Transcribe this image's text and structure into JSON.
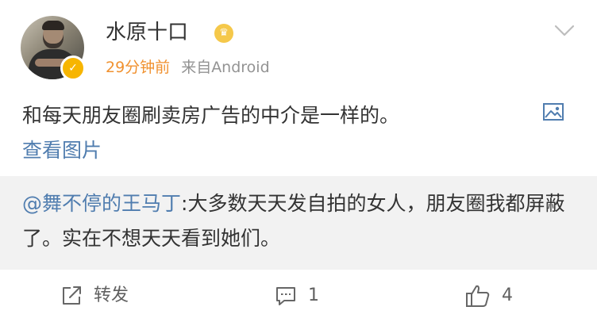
{
  "post": {
    "author": "水原十口",
    "time": "29分钟前",
    "source": "来自Android",
    "text": "和每天朋友圈刷卖房广告的中介是一样的。",
    "view_images": "查看图片"
  },
  "repost": {
    "mention": "@舞不停的王马丁",
    "text": ":大多数天天发自拍的女人，朋友圈我都屏蔽了。实在不想天天看到她们。"
  },
  "actions": {
    "repost_label": "转发",
    "comment_count": "1",
    "like_count": "4"
  },
  "colors": {
    "link": "#507daf",
    "time": "#f0912f",
    "repost_bg": "#f2f2f2",
    "verified": "#f7b500"
  },
  "icons": {
    "verified": "v-badge-icon",
    "member": "member-badge-icon",
    "dropdown": "chevron-down-icon",
    "image": "image-icon",
    "repost": "repost-icon",
    "comment": "comment-icon",
    "like": "thumbs-up-icon"
  }
}
